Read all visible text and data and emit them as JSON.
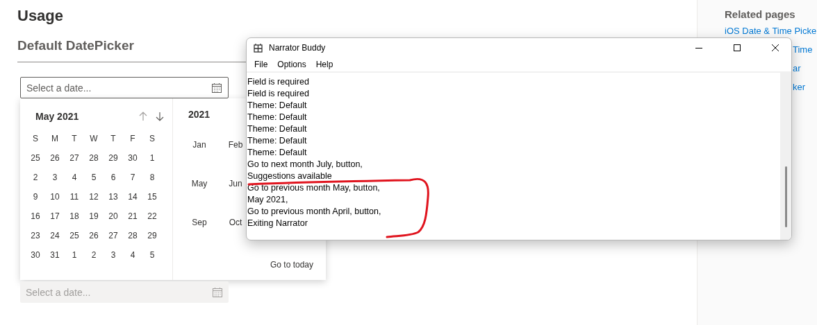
{
  "page": {
    "title": "Usage",
    "section": "Default DatePicker"
  },
  "date_field": {
    "placeholder": "Select a date..."
  },
  "calendar": {
    "month_label": "May 2021",
    "weekdays": [
      "S",
      "M",
      "T",
      "W",
      "T",
      "F",
      "S"
    ],
    "weeks": [
      [
        "25",
        "26",
        "27",
        "28",
        "29",
        "30",
        "1"
      ],
      [
        "2",
        "3",
        "4",
        "5",
        "6",
        "7",
        "8"
      ],
      [
        "9",
        "10",
        "11",
        "12",
        "13",
        "14",
        "15"
      ],
      [
        "16",
        "17",
        "18",
        "19",
        "20",
        "21",
        "22"
      ],
      [
        "23",
        "24",
        "25",
        "26",
        "27",
        "28",
        "29"
      ],
      [
        "30",
        "31",
        "1",
        "2",
        "3",
        "4",
        "5"
      ]
    ],
    "year_label": "2021",
    "months": [
      [
        "Jan",
        "Feb"
      ],
      [
        "May",
        "Jun"
      ],
      [
        "Sep",
        "Oct"
      ]
    ],
    "go_today": "Go to today"
  },
  "second_field": {
    "placeholder": "Select a date...",
    "disabled": true
  },
  "sidebar": {
    "title": "Related pages",
    "links": [
      {
        "label": "iOS Date & Time Picke",
        "kind": "full"
      },
      {
        "label": "Time",
        "kind": "partial"
      },
      {
        "label": "ar",
        "kind": "partial"
      },
      {
        "label": "ker",
        "kind": "partial"
      }
    ]
  },
  "narrator": {
    "title": "Narrator Buddy",
    "menus": [
      "File",
      "Options",
      "Help"
    ],
    "lines": [
      "Field is required",
      "Field is required",
      "Theme: Default",
      "Theme: Default",
      "Theme: Default",
      "Theme: Default",
      "Theme: Default",
      "Go to next month July, button,",
      "Suggestions available",
      "Go to previous month May, button,",
      "May 2021,",
      "Go to previous month April, button,",
      "Exiting Narrator"
    ]
  }
}
